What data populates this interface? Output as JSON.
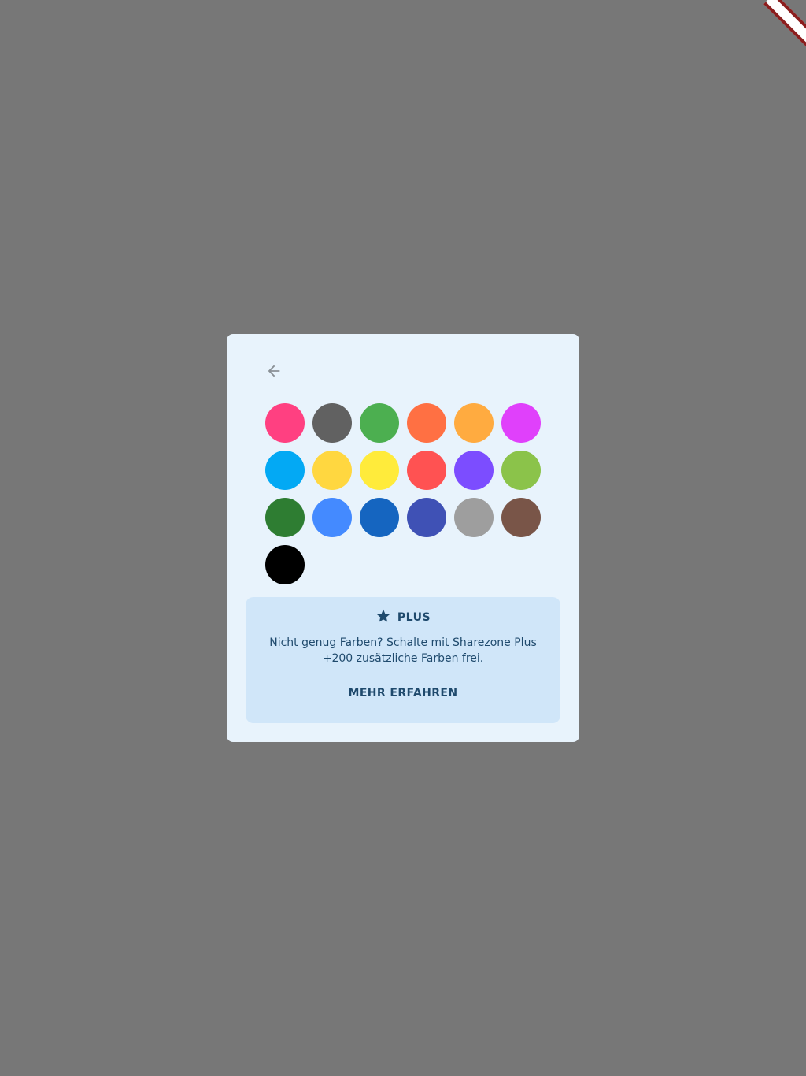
{
  "icons": {
    "back": "arrow-back-icon",
    "plus_badge": "star-icon"
  },
  "colors": {
    "background_scrim": "#777777",
    "dialog_background": "#e8f3fc",
    "plus_card_background": "#d0e6f9",
    "plus_text": "#1f4a6d",
    "back_icon": "#8a9096"
  },
  "swatches": [
    {
      "color": "#FF4081"
    },
    {
      "color": "#616161"
    },
    {
      "color": "#4CAF50"
    },
    {
      "color": "#FF7043"
    },
    {
      "color": "#FFAB40"
    },
    {
      "color": "#E040FB"
    },
    {
      "color": "#03A9F4"
    },
    {
      "color": "#FFD740"
    },
    {
      "color": "#FFEB3B"
    },
    {
      "color": "#FF5252"
    },
    {
      "color": "#7C4DFF"
    },
    {
      "color": "#8BC34A"
    },
    {
      "color": "#2E7D32"
    },
    {
      "color": "#448AFF"
    },
    {
      "color": "#1565C0"
    },
    {
      "color": "#3F51B5"
    },
    {
      "color": "#9E9E9E"
    },
    {
      "color": "#795548"
    },
    {
      "color": "#000000"
    }
  ],
  "plus": {
    "label": "PLUS",
    "description": "Nicht genug Farben? Schalte mit Sharezone Plus +200 zusätzliche Farben frei.",
    "action_label": "MEHR ERFAHREN"
  }
}
